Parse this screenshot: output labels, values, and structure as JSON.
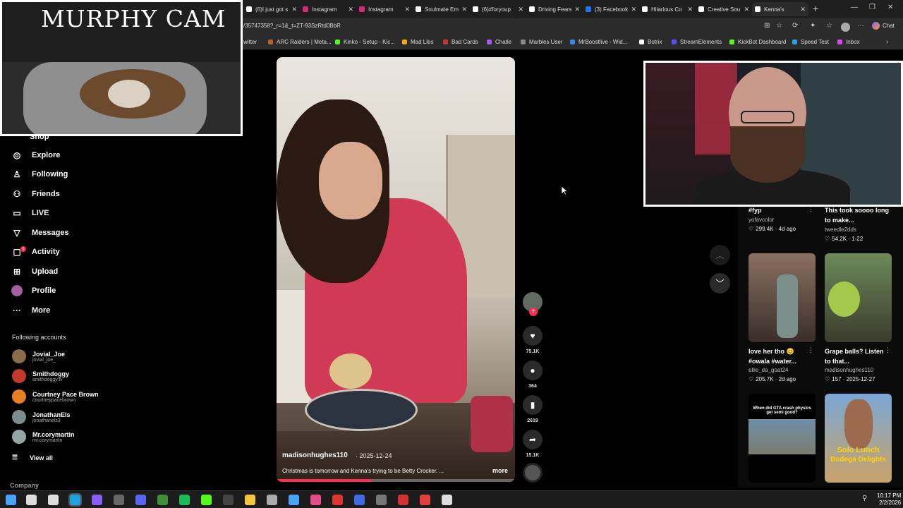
{
  "browser": {
    "tabs": [
      {
        "label": "(6)I just got s",
        "color": "#111"
      },
      {
        "label": "Instagram",
        "color": "#d62976"
      },
      {
        "label": "Instagram",
        "color": "#d62976"
      },
      {
        "label": "Soulmate Em",
        "color": "#111"
      },
      {
        "label": "(6)#foryoup",
        "color": "#111"
      },
      {
        "label": "Driving Fears",
        "color": "#111"
      },
      {
        "label": "(3) Facebook",
        "color": "#1877f2"
      },
      {
        "label": "Hilarious Co",
        "color": "#111"
      },
      {
        "label": "Creative Sou",
        "color": "#111"
      },
      {
        "label": "Kenna's",
        "color": "#111",
        "active": true
      }
    ],
    "url": "/35747358?_r=1&_t=ZT-93SzRtd0BbR",
    "chat_label": "Chat",
    "bookmarks": [
      {
        "label": "witter",
        "color": "#000"
      },
      {
        "label": "ARC Raiders | Meta...",
        "color": "#b5652b"
      },
      {
        "label": "Kinko - Setup - Kic...",
        "color": "#53fc18"
      },
      {
        "label": "Mad Libs",
        "color": "#f2a900"
      },
      {
        "label": "Bad Cards",
        "color": "#c0392b"
      },
      {
        "label": "Chatle",
        "color": "#a855f7"
      },
      {
        "label": "Marbles User",
        "color": "#888"
      },
      {
        "label": "MrBoostlive - Wid...",
        "color": "#3b82f6"
      },
      {
        "label": "Botrix",
        "color": "#fff"
      },
      {
        "label": "StreamElements",
        "color": "#5b4bff"
      },
      {
        "label": "KickBot Dashboard",
        "color": "#53fc18"
      },
      {
        "label": "Speed Test",
        "color": "#22a5e6"
      },
      {
        "label": "Inbox",
        "color": "#d946ef"
      }
    ]
  },
  "sidebar": {
    "shop_partial": "Shop",
    "nav": [
      {
        "label": "Explore",
        "icon": "compass-icon",
        "glyph": "◎"
      },
      {
        "label": "Following",
        "icon": "person-follow-icon",
        "glyph": "♙"
      },
      {
        "label": "Friends",
        "icon": "friends-icon",
        "glyph": "⚇"
      },
      {
        "label": "LIVE",
        "icon": "live-icon",
        "glyph": "▭"
      },
      {
        "label": "Messages",
        "icon": "messages-icon",
        "glyph": "▽"
      },
      {
        "label": "Activity",
        "icon": "activity-icon",
        "glyph": "▢"
      },
      {
        "label": "Upload",
        "icon": "upload-icon",
        "glyph": "⊞"
      },
      {
        "label": "Profile",
        "icon": "profile-icon",
        "glyph": "●"
      },
      {
        "label": "More",
        "icon": "more-icon",
        "glyph": "···"
      }
    ],
    "activity_badge": "6",
    "following_title": "Following accounts",
    "accounts": [
      {
        "name": "Jovial_Joe",
        "handle": "jovial_joe_",
        "color": "#8a6b4a"
      },
      {
        "name": "Smithdoggy",
        "handle": "smithdoggy.tv",
        "color": "#c0392b"
      },
      {
        "name": "Courtney Pace Brown",
        "handle": "courtneypacebrown",
        "color": "#e67e22"
      },
      {
        "name": "JonathanEls",
        "handle": "jonathanels3",
        "color": "#7f8c8d"
      },
      {
        "name": "Mr.corymartin",
        "handle": "mr.corymartin",
        "color": "#95a5a6"
      }
    ],
    "view_all": "View all",
    "company": "Company"
  },
  "video": {
    "author": "madisonhughes110",
    "date": "· 2025-12-24",
    "caption": "Christmas is tomorrow and Kenna's trying to be Betty Crocker. ...",
    "more": "more",
    "progress": 0.4
  },
  "actions": {
    "likes": "75.1K",
    "comments": "364",
    "saves": "2619",
    "shares": "15.1K"
  },
  "feed": [
    {
      "title": "#fyp",
      "author": "yofavcolor",
      "stats": "299.4K · 4d ago"
    },
    {
      "title": "This took soooo long to make...",
      "author": "tweedle2dds",
      "stats": "54.2K · 1-22"
    },
    {
      "title": "love her tho 😊 #owala #water...",
      "author": "ellie_da_goat24",
      "stats": "205.7K · 2d ago"
    },
    {
      "title": "Grape balls? Listen to that...",
      "author": "madisonhughes110",
      "stats": "157 · 2025-12-27"
    }
  ],
  "thumb_texts": {
    "gta": "When did GTA crash physics get semi good?",
    "lunch_line1": "Solo Lunch",
    "lunch_line2": "Bodega Delights"
  },
  "overlay": {
    "murphy_title": "MURPHY CAM"
  },
  "taskbar": {
    "time": "10:17 PM",
    "date": "2/2/2026"
  }
}
